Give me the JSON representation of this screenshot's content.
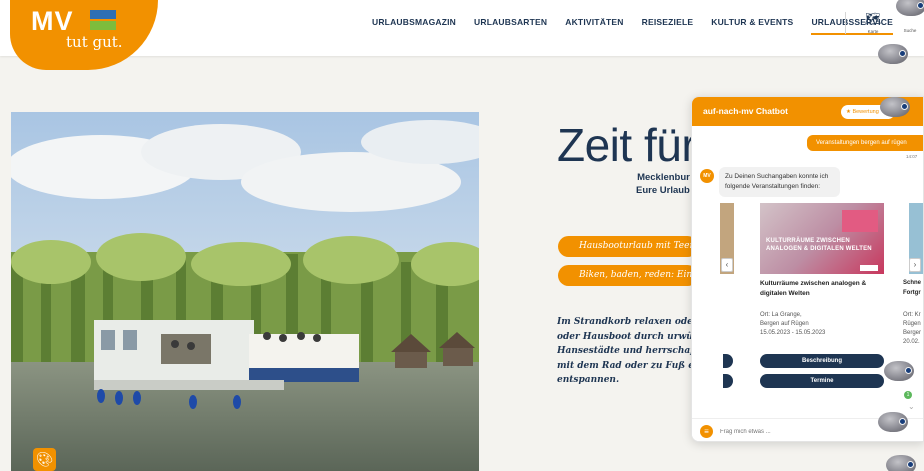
{
  "header": {
    "logo": {
      "brand": "MV",
      "tagline": "tut gut."
    },
    "nav": [
      "URLAUBSMAGAZIN",
      "URLAUBSARTEN",
      "AKTIVITÄTEN",
      "REISEZIELE",
      "KULTUR & EVENTS",
      "URLAUBSSERVICE"
    ],
    "active_nav": "URLAUBSSERVICE",
    "map_label": "Karte",
    "search_label": "Suche"
  },
  "hero": {
    "headline": "Zeit für",
    "subline": "Mecklenbur\nEure Urlaub",
    "pills": [
      "Hausbooturlaub mit Teena",
      "Biken, baden, reden: Ein Re"
    ],
    "body": "Im Strandkorb relaxen oder d\noder Hausboot durch urwüch\nHansestädte und herrschaftli\nmit dem Rad oder zu Fuß erw\nentspannen."
  },
  "chatbot": {
    "title": "auf-nach-mv Chatbot",
    "rate_label": "★ Bewertung",
    "user_message": "Veranstaltungen bergen auf rügen",
    "time": "14:07",
    "bot_avatar": "MV",
    "bot_message": "Zu Deinen Suchangaben konnte ich folgende Veranstaltungen finden:",
    "card": {
      "image_text_1": "KULTURRÄUME ZWISCHEN",
      "image_text_2": "ANALOGEN & DIGITALEN WELTEN",
      "title": "Kulturräume zwischen analogen & digitalen Welten",
      "place": "Ort: La Grange,",
      "city": "Bergen auf Rügen",
      "dates": "15.05.2023 - 15.05.2023",
      "description_button": "Beschreibung",
      "dates_button": "Termine"
    },
    "next_card": {
      "title_line1": "Schne",
      "title_line2": "Fortgr",
      "meta_line1": "Ort: Kr",
      "meta_line2": "Rügen",
      "meta_line3": "Berger",
      "meta_line4": "20.02."
    },
    "arrow_left": "‹",
    "arrow_right": "›",
    "input_placeholder": "Frag mich etwas ...",
    "badge": "1",
    "menu_icon": "≡"
  },
  "colors": {
    "accent": "#f29100",
    "navy": "#1e3552"
  },
  "icons": [
    "map-icon",
    "search-icon",
    "palette-icon",
    "star-icon",
    "chevron-left-icon",
    "chevron-right-icon",
    "menu-icon",
    "robot-icon"
  ]
}
